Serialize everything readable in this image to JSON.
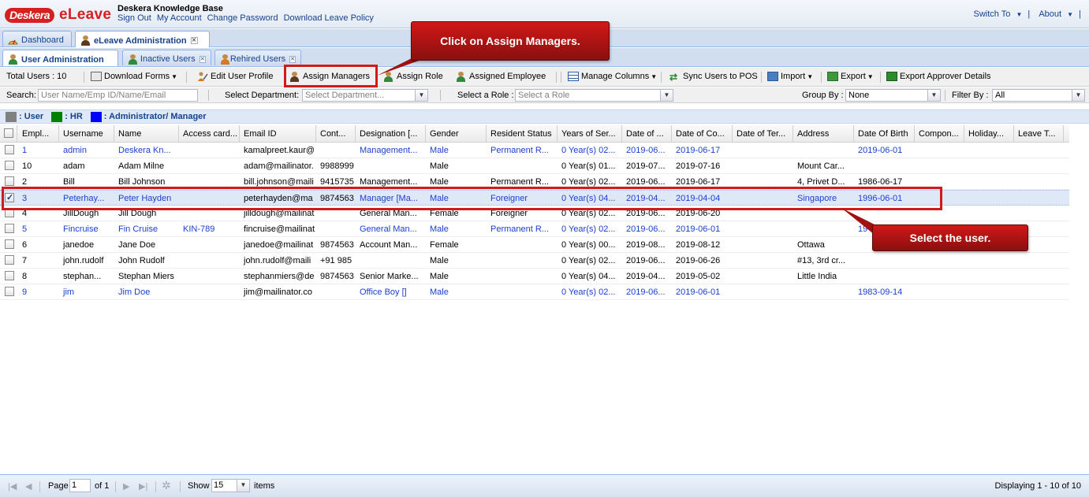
{
  "header": {
    "logo_badge": "Deskera",
    "logo_name": "eLeave",
    "kb_title": "Deskera Knowledge Base",
    "links": [
      "Sign Out",
      "My Account",
      "Change Password",
      "Download Leave Policy"
    ],
    "switch_to": "Switch To",
    "about": "About",
    "separator": "|"
  },
  "main_tabs": [
    {
      "label": "Dashboard",
      "icon": "dashboard-icon"
    },
    {
      "label": "eLeave Administration",
      "icon": "user-icon",
      "active": true
    }
  ],
  "sub_tabs": [
    {
      "label": "User Administration",
      "active": true
    },
    {
      "label": "Inactive Users"
    },
    {
      "label": "Rehired Users"
    }
  ],
  "toolbar": {
    "total_users": "Total Users : 10",
    "download_forms": "Download Forms",
    "edit_user_profile": "Edit User Profile",
    "assign_managers": "Assign Managers",
    "assign_role": "Assign Role",
    "assigned_employee": "Assigned Employee",
    "manage_columns": "Manage Columns",
    "sync_users": "Sync Users to POS",
    "import": "Import",
    "export": "Export",
    "export_approver": "Export Approver Details"
  },
  "filters": {
    "search_label": "Search:",
    "search_placeholder": "User Name/Emp ID/Name/Email",
    "dept_label": "Select Department:",
    "dept_placeholder": "Select Department...",
    "role_label": "Select a Role :",
    "role_placeholder": "Select a Role",
    "group_label": "Group By :",
    "group_value": "None",
    "filter_label": "Filter By :",
    "filter_value": "All"
  },
  "legend": {
    "user": ": User",
    "hr": ": HR",
    "admin": ": Administrator/ Manager",
    "colors": {
      "user": "#808080",
      "hr": "#008000",
      "admin": "#0000ff"
    }
  },
  "columns": [
    "Empl...",
    "Username",
    "Name",
    "Access card...",
    "Email ID",
    "Cont...",
    "Designation [...",
    "Gender",
    "Resident Status",
    "Years of Ser...",
    "Date of ...",
    "Date of Co...",
    "Date of Ter...",
    "Address",
    "Date Of Birth",
    "Compon...",
    "Holiday...",
    "Leave T..."
  ],
  "rows": [
    {
      "blue": true,
      "checked": false,
      "cells": [
        "1",
        "admin",
        "Deskera Kn...",
        "",
        "kamalpreet.kaur@",
        "",
        "Management...",
        "Male",
        "Permanent R...",
        "0 Year(s) 02...",
        "2019-06...",
        "2019-06-17",
        "",
        "",
        "2019-06-01",
        "",
        "",
        ""
      ]
    },
    {
      "blue": false,
      "checked": false,
      "cells": [
        "10",
        "adam",
        "Adam Milne",
        "",
        "adam@mailinator.",
        "9988999",
        "",
        "Male",
        "",
        "0 Year(s) 01...",
        "2019-07...",
        "2019-07-16",
        "",
        "Mount Car...",
        "",
        "",
        "",
        ""
      ]
    },
    {
      "blue": false,
      "checked": false,
      "cells": [
        "2",
        "Bill",
        "Bill Johnson",
        "",
        "bill.johnson@maili",
        "9415735",
        "Management...",
        "Male",
        "Permanent R...",
        "0 Year(s) 02...",
        "2019-06...",
        "2019-06-17",
        "",
        "4, Privet D...",
        "1986-06-17",
        "",
        "",
        ""
      ]
    },
    {
      "blue": true,
      "checked": true,
      "cells": [
        "3",
        "Peterhay...",
        "Peter Hayden",
        "",
        "peterhayden@ma",
        "9874563",
        "Manager [Ma...",
        "Male",
        "Foreigner",
        "0 Year(s) 04...",
        "2019-04...",
        "2019-04-04",
        "",
        "Singapore",
        "1996-06-01",
        "",
        "",
        ""
      ]
    },
    {
      "blue": false,
      "checked": false,
      "cells": [
        "4",
        "JillDough",
        "Jill Dough",
        "",
        "jilldough@mailinat",
        "",
        "General Man...",
        "Female",
        "Foreigner",
        "0 Year(s) 02...",
        "2019-06...",
        "2019-06-20",
        "",
        "",
        "",
        "",
        "",
        ""
      ]
    },
    {
      "blue": true,
      "checked": false,
      "cells": [
        "5",
        "Fincruise",
        "Fin Cruise",
        "KIN-789",
        "fincruise@mailinat",
        "",
        "General Man...",
        "Male",
        "Permanent R...",
        "0 Year(s) 02...",
        "2019-06...",
        "2019-06-01",
        "",
        "",
        "19",
        "",
        "",
        ""
      ]
    },
    {
      "blue": false,
      "checked": false,
      "cells": [
        "6",
        "janedoe",
        "Jane Doe",
        "",
        "janedoe@mailinat",
        "9874563",
        "Account Man...",
        "Female",
        "",
        "0 Year(s) 00...",
        "2019-08...",
        "2019-08-12",
        "",
        "Ottawa",
        "",
        "",
        "",
        ""
      ]
    },
    {
      "blue": false,
      "checked": false,
      "cells": [
        "7",
        "john.rudolf",
        "John Rudolf",
        "",
        "john.rudolf@maili",
        "+91 985",
        "",
        "Male",
        "",
        "0 Year(s) 02...",
        "2019-06...",
        "2019-06-26",
        "",
        "#13, 3rd cr...",
        "",
        "",
        "",
        ""
      ]
    },
    {
      "blue": false,
      "checked": false,
      "cells": [
        "8",
        "stephan...",
        "Stephan Miers",
        "",
        "stephanmiers@de",
        "9874563",
        "Senior Marke...",
        "Male",
        "",
        "0 Year(s) 04...",
        "2019-04...",
        "2019-05-02",
        "",
        "Little India",
        "",
        "",
        "",
        ""
      ]
    },
    {
      "blue": true,
      "checked": false,
      "cells": [
        "9",
        "jim",
        "Jim Doe",
        "",
        "jim@mailinator.co",
        "",
        "Office Boy []",
        "Male",
        "",
        "0 Year(s) 02...",
        "2019-06...",
        "2019-06-01",
        "",
        "",
        "1983-09-14",
        "",
        "",
        ""
      ]
    }
  ],
  "paging": {
    "page_label": "Page",
    "page_value": "1",
    "of_label": "of 1",
    "show_label": "Show",
    "show_value": "15",
    "items_label": "items",
    "displaying": "Displaying 1 - 10 of 10"
  },
  "annotations": {
    "assign_callout": "Click on Assign Managers.",
    "select_callout": "Select the user."
  }
}
